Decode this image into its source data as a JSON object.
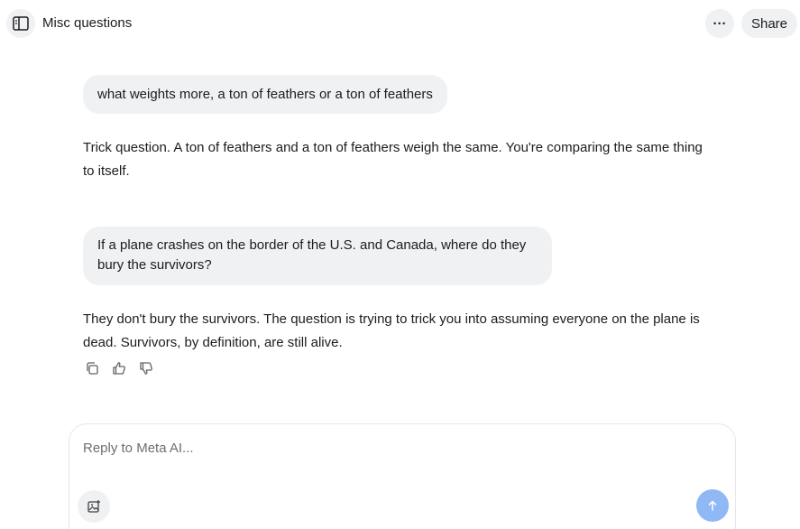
{
  "header": {
    "title": "Misc questions",
    "more_label": "···",
    "share_label": "Share"
  },
  "messages": [
    {
      "role": "user",
      "text": "what weights more, a ton of feathers or a ton of feathers"
    },
    {
      "role": "assistant",
      "text": "Trick question. A ton of feathers and a ton of feathers weigh the same. You're comparing the same thing to itself."
    },
    {
      "role": "user",
      "text": "If a plane crashes on the border of the U.S. and Canada, where do they bury the survivors?"
    },
    {
      "role": "assistant",
      "text": "They don't bury the survivors. The question is trying to trick you into assuming everyone on the plane is dead. Survivors, by definition, are still alive."
    }
  ],
  "feedback_icons": [
    "copy-icon",
    "thumbs-up-icon",
    "thumbs-down-icon"
  ],
  "composer": {
    "placeholder": "Reply to Meta AI...",
    "value": ""
  },
  "colors": {
    "bubble_bg": "#f0f1f3",
    "send_button": "#8fb8f5",
    "text": "#1c1c1e"
  }
}
